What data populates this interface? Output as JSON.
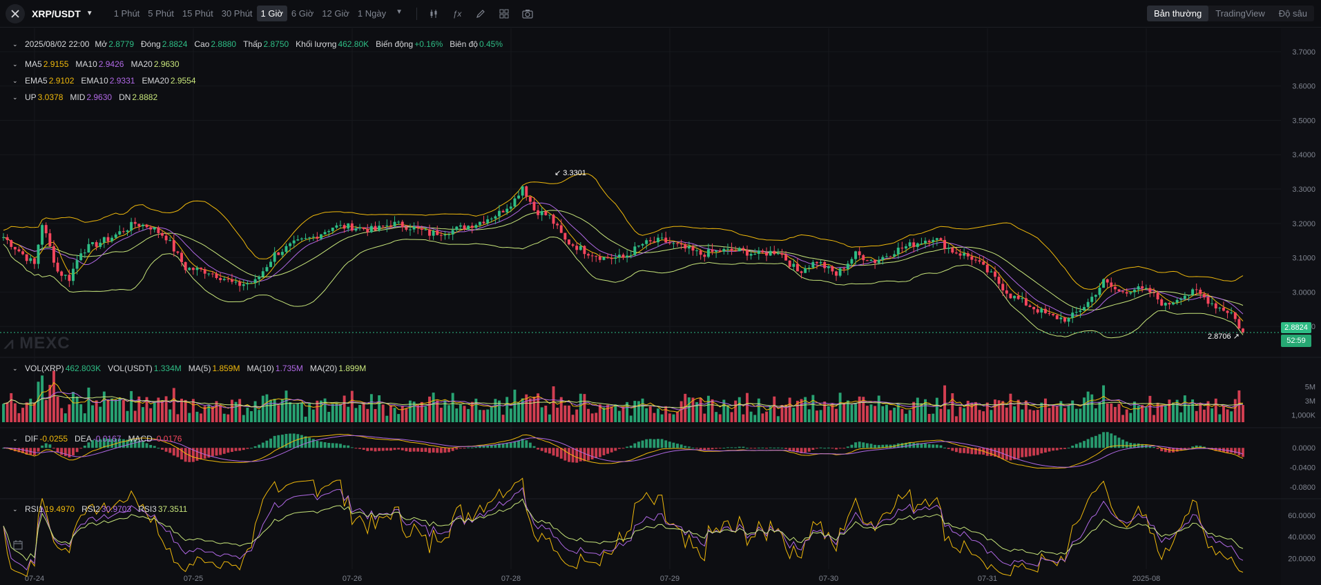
{
  "toolbar": {
    "symbol": "XRP/USDT",
    "timeframes": [
      "1 Phút",
      "5 Phút",
      "15 Phút",
      "30 Phút",
      "1 Giờ",
      "6 Giờ",
      "12 Giờ",
      "1 Ngày"
    ],
    "active_timeframe": "1 Giờ",
    "view_modes": [
      "Bản thường",
      "TradingView",
      "Độ sâu"
    ],
    "active_view": "Bản thường",
    "icons": [
      "candle-type-icon",
      "indicator-fx-icon",
      "draw-pencil-icon",
      "layout-grid-icon",
      "camera-icon"
    ]
  },
  "ohlc": {
    "date": "2025/08/02 22:00",
    "open_label": "Mở",
    "open": "2.8779",
    "close_label": "Đóng",
    "close": "2.8824",
    "high_label": "Cao",
    "high": "2.8880",
    "low_label": "Thấp",
    "low": "2.8750",
    "volume_label": "Khối lượng",
    "volume": "462.80K",
    "change_label": "Biến động",
    "change": "+0.16%",
    "amplitude_label": "Biên độ",
    "amplitude": "0.45%"
  },
  "ma": {
    "ma5_label": "MA5",
    "ma5": "2.9155",
    "ma10_label": "MA10",
    "ma10": "2.9426",
    "ma20_label": "MA20",
    "ma20": "2.9630"
  },
  "ema": {
    "ema5_label": "EMA5",
    "ema5": "2.9102",
    "ema10_label": "EMA10",
    "ema10": "2.9331",
    "ema20_label": "EMA20",
    "ema20": "2.9554"
  },
  "boll": {
    "up_label": "UP",
    "up": "3.0378",
    "mid_label": "MID",
    "mid": "2.9630",
    "dn_label": "DN",
    "dn": "2.8882"
  },
  "vol_legend": {
    "vol_xrp_label": "VOL(XRP)",
    "vol_xrp": "462.803K",
    "vol_usdt_label": "VOL(USDT)",
    "vol_usdt": "1.334M",
    "ma5_label": "MA(5)",
    "ma5": "1.859M",
    "ma10_label": "MA(10)",
    "ma10": "1.735M",
    "ma20_label": "MA(20)",
    "ma20": "1.899M"
  },
  "macd_legend": {
    "dif_label": "DIF",
    "dif": "-0.0255",
    "dea_label": "DEA",
    "dea": "-0.0167",
    "macd_label": "MACD",
    "macd": "-0.0176"
  },
  "rsi_legend": {
    "rsi1_label": "RSI1",
    "rsi1": "19.4970",
    "rsi2_label": "RSI2",
    "rsi2": "30.9703",
    "rsi3_label": "RSI3",
    "rsi3": "37.3511"
  },
  "watermark": "MEXC",
  "price_tag": {
    "price": "2.8824",
    "countdown": "52:59"
  },
  "marks": {
    "high": "3.3301",
    "low": "2.8706"
  },
  "colors": {
    "up": "#2ebd85",
    "down": "#f6465d",
    "ma5": "#f0b90b",
    "ma10": "#b169e6",
    "ma20": "#c8e67b",
    "boll": "#f0b90b"
  },
  "chart_data": {
    "type": "candlestick",
    "price_axis": {
      "ticks": [
        "3.7000",
        "3.6000",
        "3.5000",
        "3.4000",
        "3.3000",
        "3.2000",
        "3.1000",
        "3.0000",
        "2.9000"
      ],
      "ylim": [
        2.81,
        3.76
      ]
    },
    "vol_axis": {
      "ticks": [
        "5M",
        "3M",
        "1,000K"
      ]
    },
    "macd_axis": {
      "ticks": [
        "0.0000",
        "-0.0400",
        "-0.0800"
      ]
    },
    "rsi_axis": {
      "ticks": [
        "60.0000",
        "40.0000",
        "20.0000"
      ]
    },
    "x_labels": [
      "07-24",
      "07-25",
      "07-26",
      "07-28",
      "07-29",
      "07-30",
      "07-31",
      "2025-08"
    ],
    "anchors": [
      [
        0,
        3.16
      ],
      [
        3,
        3.13
      ],
      [
        8,
        3.08
      ],
      [
        10,
        3.2
      ],
      [
        14,
        3.06
      ],
      [
        17,
        3.04
      ],
      [
        20,
        3.12
      ],
      [
        28,
        3.16
      ],
      [
        34,
        3.2
      ],
      [
        38,
        3.19
      ],
      [
        42,
        3.16
      ],
      [
        47,
        3.07
      ],
      [
        53,
        3.06
      ],
      [
        57,
        3.04
      ],
      [
        60,
        3.02
      ],
      [
        65,
        3.03
      ],
      [
        70,
        3.11
      ],
      [
        75,
        3.14
      ],
      [
        80,
        3.16
      ],
      [
        85,
        3.19
      ],
      [
        90,
        3.19
      ],
      [
        96,
        3.18
      ],
      [
        100,
        3.2
      ],
      [
        105,
        3.19
      ],
      [
        110,
        3.17
      ],
      [
        116,
        3.18
      ],
      [
        122,
        3.2
      ],
      [
        128,
        3.23
      ],
      [
        132,
        3.27
      ],
      [
        134,
        3.31
      ],
      [
        137,
        3.24
      ],
      [
        141,
        3.22
      ],
      [
        145,
        3.15
      ],
      [
        150,
        3.12
      ],
      [
        155,
        3.1
      ],
      [
        160,
        3.1
      ],
      [
        165,
        3.14
      ],
      [
        170,
        3.15
      ],
      [
        175,
        3.13
      ],
      [
        180,
        3.11
      ],
      [
        185,
        3.12
      ],
      [
        190,
        3.12
      ],
      [
        195,
        3.11
      ],
      [
        200,
        3.12
      ],
      [
        205,
        3.06
      ],
      [
        210,
        3.09
      ],
      [
        215,
        3.05
      ],
      [
        220,
        3.11
      ],
      [
        225,
        3.09
      ],
      [
        230,
        3.12
      ],
      [
        235,
        3.14
      ],
      [
        240,
        3.16
      ],
      [
        245,
        3.12
      ],
      [
        250,
        3.1
      ],
      [
        255,
        3.05
      ],
      [
        260,
        2.99
      ],
      [
        265,
        2.96
      ],
      [
        270,
        2.93
      ],
      [
        275,
        2.92
      ],
      [
        280,
        2.97
      ],
      [
        284,
        3.03
      ],
      [
        288,
        3.0
      ],
      [
        292,
        3.01
      ],
      [
        296,
        3.0
      ],
      [
        300,
        2.96
      ],
      [
        304,
        2.99
      ],
      [
        308,
        3.0
      ],
      [
        313,
        2.96
      ],
      [
        317,
        2.94
      ],
      [
        320,
        2.88
      ]
    ]
  }
}
